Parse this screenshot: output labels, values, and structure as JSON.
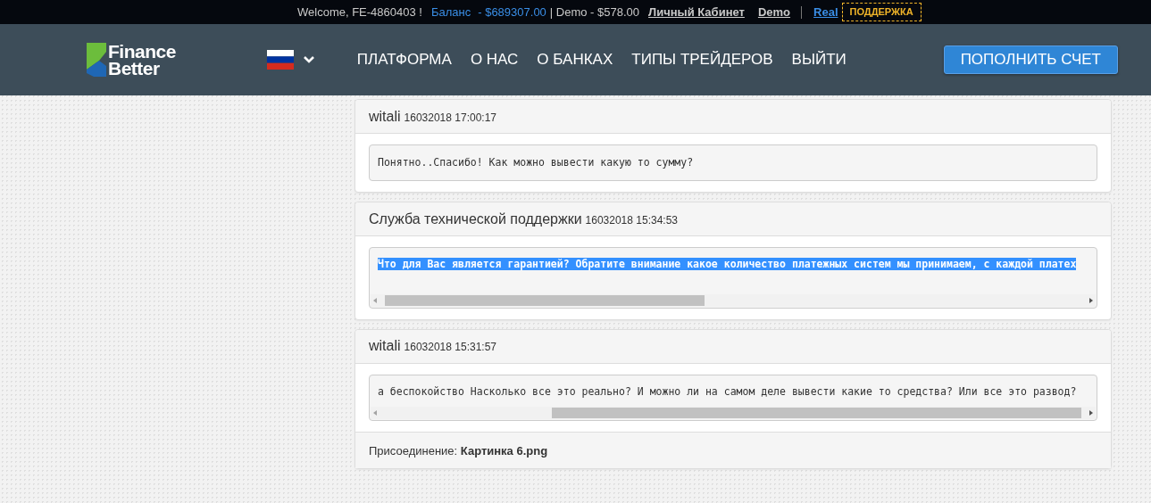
{
  "top_bar": {
    "welcome": "Welcome, FE-4860403 !",
    "balance_label": "Баланс",
    "balance_value": "- $689307.00",
    "demo_balance": "| Demo - $578.00",
    "cabinet_link": "Личный Кабинет",
    "modes": [
      {
        "label": "Demo",
        "selected": false
      },
      {
        "label": "Real",
        "selected": true
      }
    ],
    "support_button": "ПОДДЕРЖКА"
  },
  "header": {
    "logo": {
      "line_1": "Finance",
      "line_2": "Better"
    },
    "nav": [
      "ПЛАТФОРМА",
      "О НАС",
      "О БАНКАХ",
      "ТИПЫ ТРЕЙДЕРОВ",
      "ВЫЙТИ"
    ],
    "deposit_button": "ПОПОЛНИТЬ СЧЕТ"
  },
  "messages": [
    {
      "author": "witali",
      "time": "16032018 17:00:17",
      "text": "Понятно..Спасибо! Как можно вывести какую то сумму?",
      "selected": false,
      "kind": "plain"
    },
    {
      "author": "Служба технической поддержки",
      "time": "16032018 15:34:53",
      "text": "Что для Вас является гарантией? Обратите внимание какое количество платежных систем мы принимаем, с каждой платех",
      "selected": true,
      "kind": "scrollable",
      "scrolled_to_end": false
    },
    {
      "author": "witali",
      "time": "16032018 15:31:57",
      "text": "а беспокойство Насколько все это реально? И можно ли на самом деле вывести какие то средства? Или все это развод?",
      "selected": false,
      "kind": "scrollable",
      "scrolled_to_end": true,
      "attachment": "Присоединение: **Картинка 6.png**"
    }
  ]
}
